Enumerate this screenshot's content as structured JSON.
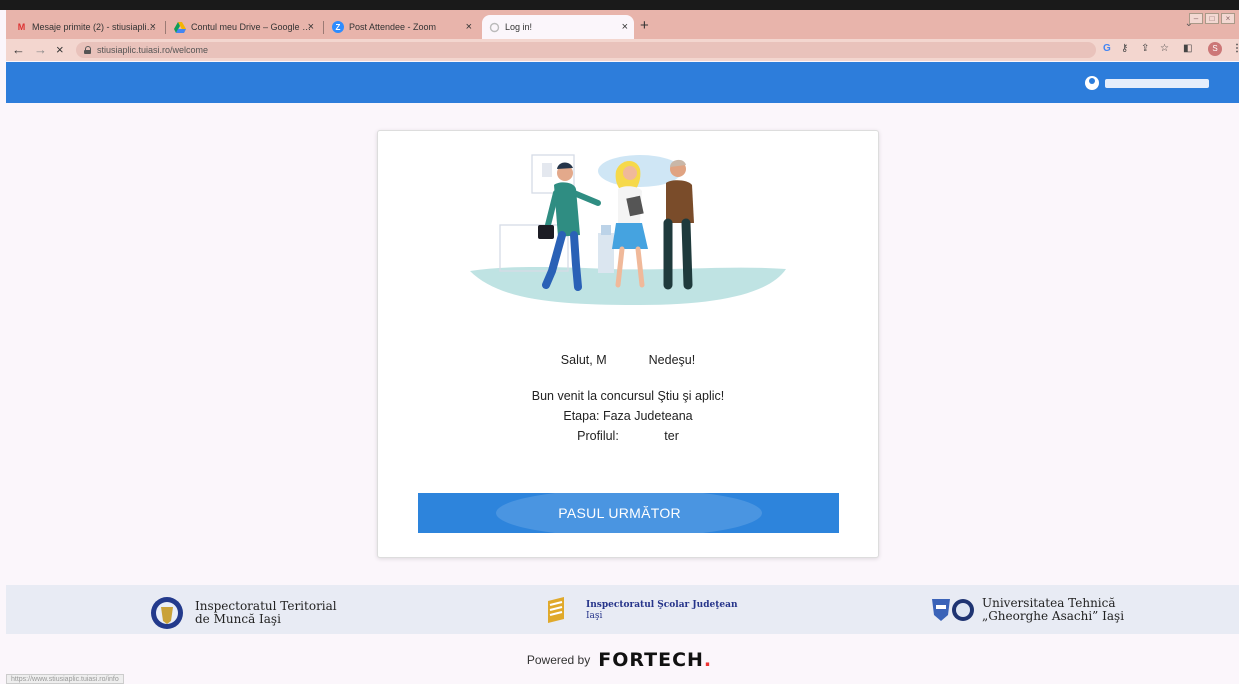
{
  "browser": {
    "tabs": [
      {
        "label": "Mesaje primite (2) - stiusiaplic@...",
        "icon": "gmail-icon"
      },
      {
        "label": "Contul meu Drive – Google Drive",
        "icon": "google-drive-icon"
      },
      {
        "label": "Post Attendee - Zoom",
        "icon": "zoom-icon"
      },
      {
        "label": "Log in!",
        "icon": "loading-icon"
      }
    ],
    "url": "stiusiaplic.tuiasi.ro/welcome",
    "profile_initial": "S",
    "status_url": "https://www.stiusiaplic.tuiasi.ro/info"
  },
  "header": {
    "username": "●●●●●●●●●●"
  },
  "welcome": {
    "greeting_prefix": "Salut, ",
    "greeting_mid": "M",
    "greeting_suffix": "Nedeşu!",
    "line1": "Bun venit la concursul Ştiu şi aplic!",
    "line2": "Etapa: Faza Judeteana",
    "line3_prefix": "Profilul: ",
    "line3_suffix": "ter",
    "button_label": "PASUL URMĂTOR"
  },
  "footer": {
    "partner1_line1": "Inspectoratul Teritorial",
    "partner1_line2": "de Muncă Iaşi",
    "partner2_line1": "Inspectoratul Şcolar Judeţean",
    "partner2_line2": "Iaşi",
    "partner3_line1": "Universitatea Tehnică",
    "partner3_line2": "„Gheorghe Asachi” Iaşi",
    "powered_by": "Powered by",
    "brand": "FORTECH",
    "brand_dot": "."
  },
  "colors": {
    "appbar": "#2d7ddb",
    "button": "#2d84dc",
    "tabstrip": "#e8b4ab"
  }
}
